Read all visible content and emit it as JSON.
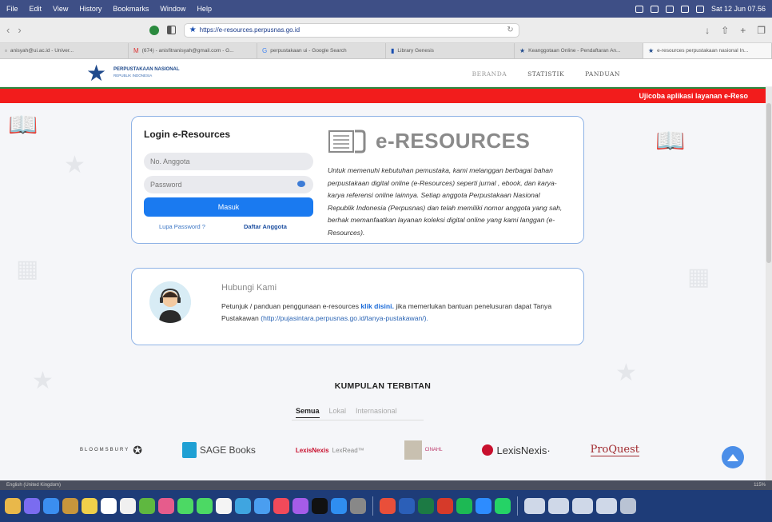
{
  "menubar": {
    "items": [
      "File",
      "Edit",
      "View",
      "History",
      "Bookmarks",
      "Window",
      "Help"
    ],
    "clock": "Sat 12 Jun 07.56"
  },
  "toolbar": {
    "url": "https://e-resources.perpusnas.go.id"
  },
  "tabs": [
    {
      "label": "anisyah@ui.ac.id - Univer...",
      "icon": "bookmark-icon"
    },
    {
      "label": "(674) - anisfitranisyah@gmail.com - G...",
      "icon": "gmail-icon"
    },
    {
      "label": "perpustakaan ui - Google Search",
      "icon": "google-icon"
    },
    {
      "label": "Library Genesis",
      "icon": "library-icon"
    },
    {
      "label": "Keanggotaan Online - Pendaftaran An...",
      "icon": "star-icon"
    },
    {
      "label": "e-resources perpustakaan nasional In...",
      "icon": "star-icon"
    }
  ],
  "site": {
    "org_name": "PERPUSTAKAAN NASIONAL",
    "org_sub": "REPUBLIK INDONESIA",
    "nav": [
      "BERANDA",
      "STATISTIK",
      "PANDUAN"
    ]
  },
  "banner": "Ujicoba aplikasi layanan e-Reso",
  "login": {
    "title": "Login e-Resources",
    "member_placeholder": "No. Anggota",
    "password_placeholder": "Password",
    "submit": "Masuk",
    "forgot": "Lupa Password ?",
    "register": "Daftar Anggota"
  },
  "eresources": {
    "title": "e-RESOURCES",
    "description": "Untuk memenuhi kebutuhan pemustaka, kami melanggan berbagai bahan perpustakaan digital online (e-Resources) seperti jurnal , ebook, dan karya-karya referensi online lainnya. Setiap anggota Perpustakaan Nasional Republik Indonesia (Perpusnas) dan telah memiliki nomor anggota yang sah, berhak memanfaatkan layanan koleksi digital online yang kami langgan (e-Resources)."
  },
  "contact": {
    "title": "Hubungi Kami",
    "text1": "Petunjuk / panduan penggunaan e-resources",
    "link1": "klik disini.",
    "text2": "jika memerlukan bantuan penelusuran dapat Tanya Pustakawan",
    "link2": "(http://pujasintara.perpusnas.go.id/tanya-pustakawan/)."
  },
  "collections": {
    "title": "KUMPULAN TERBITAN",
    "filters": [
      "Semua",
      "Lokal",
      "Internasional"
    ],
    "publishers": [
      "BLOOMSBURY",
      "SAGE Books",
      "LexisNexis",
      "LexRead™",
      "CINAHL",
      "LexisNexis·",
      "ProQuest"
    ]
  },
  "statusbar": {
    "lang": "English (United Kingdom)",
    "zoom": "115%"
  }
}
